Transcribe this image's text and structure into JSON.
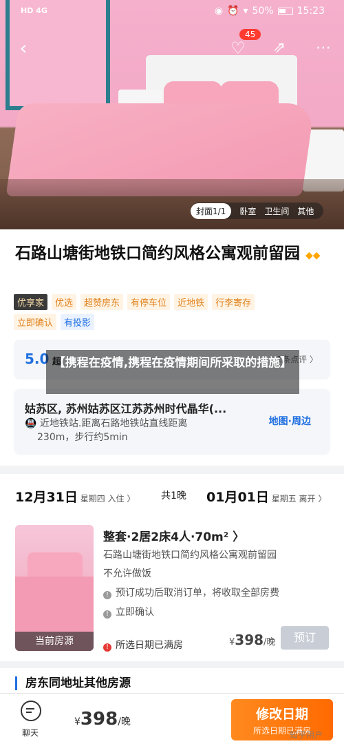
{
  "status_bar": {
    "left": "HD 4G",
    "battery": "50%",
    "time": "15:23"
  },
  "nav": {
    "favorites_count": "45"
  },
  "photo_tabs": [
    "封面1/1",
    "卧室",
    "卫生间",
    "其他"
  ],
  "hotel": {
    "name": "石路山塘街地铁口简约风格公寓观前留园",
    "diamonds": "◆◆",
    "tags_row1": [
      "优享家",
      "优选",
      "超赞房东",
      "有停车位",
      "近地铁",
      "行李寄存"
    ],
    "tags_row2": [
      "立即确认",
      "有投影"
    ],
    "score": "5.0",
    "score_label": "超",
    "reviews": "1条点评 〉",
    "address": "姑苏区, 苏州姑苏区江苏苏州时代晶华(...",
    "transit_line1": "近地铁站.距离石路地铁站直线距离",
    "transit_line2": "230m，步行约5min",
    "map_link": "地图·周边"
  },
  "overlay_caption": "【携程在疫情,携程在疫情期间所采取的措施】",
  "dates": {
    "checkin": "12月31日",
    "checkin_sub": "星期四 入住 〉",
    "nights": "共1晚",
    "checkout": "01月01日",
    "checkout_sub": "星期五 离开 〉"
  },
  "room": {
    "image_label": "当前房源",
    "name": "整套·2居2床4人·70m² 〉",
    "desc": "石路山塘街地铁口简约风格公寓观前留园",
    "note": "不允许做饭",
    "policy": "预订成功后取消订单，将收取全部房费",
    "confirm": "立即确认",
    "full": "所选日期已满房",
    "price_symbol": "¥",
    "price": "398",
    "price_unit": "/晚",
    "book_label": "预订"
  },
  "section_title": "房东同地址其他房源",
  "bottom": {
    "chat_label": "聊天",
    "price_symbol": "¥",
    "price": "398",
    "price_unit": "/晚",
    "change_btn_main": "修改日期",
    "change_btn_sub": "所选日期已满房"
  },
  "source_mark": "知乎用户"
}
